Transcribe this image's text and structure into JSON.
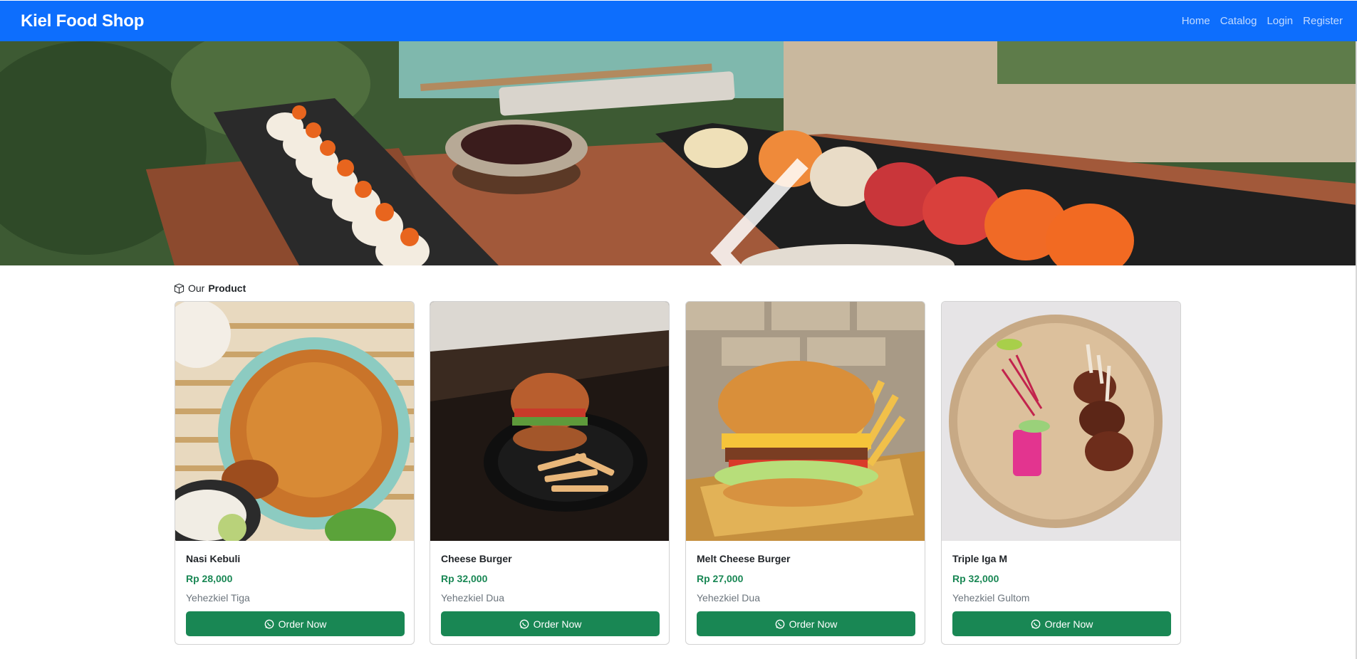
{
  "navbar": {
    "brand": "Kiel Food Shop",
    "links": [
      "Home",
      "Catalog",
      "Login",
      "Register"
    ],
    "bg_color": "#0d6efd"
  },
  "carousel": {
    "prev_icon": "chevron-left-icon",
    "next_icon": "chevron-right-icon"
  },
  "section": {
    "prefix": "Our",
    "title": "Product",
    "icon": "box-icon"
  },
  "products": [
    {
      "name": "Nasi Kebuli",
      "price": "Rp 28,000",
      "seller": "Yehezkiel Tiga",
      "button": "Order Now"
    },
    {
      "name": "Cheese Burger",
      "price": "Rp 32,000",
      "seller": "Yehezkiel Dua",
      "button": "Order Now"
    },
    {
      "name": "Melt Cheese Burger",
      "price": "Rp 27,000",
      "seller": "Yehezkiel Dua",
      "button": "Order Now"
    },
    {
      "name": "Triple Iga M",
      "price": "Rp 32,000",
      "seller": "Yehezkiel Gultom",
      "button": "Order Now"
    }
  ],
  "colors": {
    "price": "#198754",
    "button": "#198754"
  }
}
